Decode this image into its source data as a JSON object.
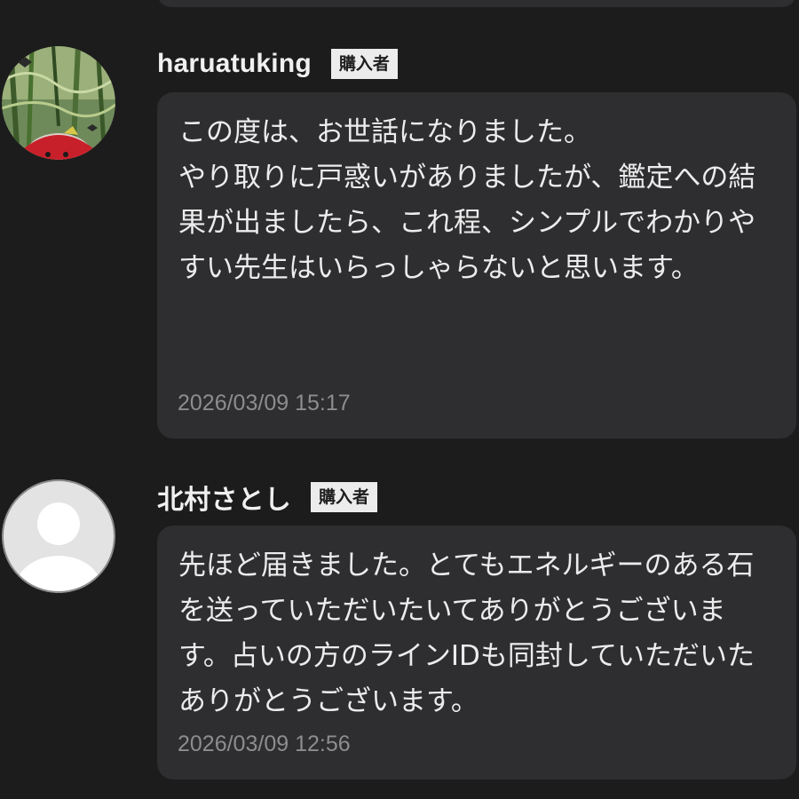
{
  "reviews": [
    {
      "name": "haruatuking",
      "badge": "購入者",
      "avatar_icon": "custom-photo-avatar-icon",
      "text": "この度は、お世話になりました。\nやり取りに戸惑いがありましたが、鑑定への結果が出ましたら、これ程、シンプルでわかりやすい先生はいらっしゃらないと思います。",
      "timestamp": "2026/03/09 15:17"
    },
    {
      "name": "北村さとし",
      "badge": "購入者",
      "avatar_icon": "default-user-avatar-icon",
      "text": "先ほど届きました。とてもエネルギーのある石を送っていただいたいてありがとうございます。占いの方のラインIDも同封していただいたありがとうございます。",
      "timestamp": "2026/03/09 12:56"
    }
  ],
  "colors": {
    "background": "#1c1c1d",
    "bubble": "#2e2e30",
    "badge_bg": "#ececec",
    "timestamp": "#8d8d90"
  }
}
